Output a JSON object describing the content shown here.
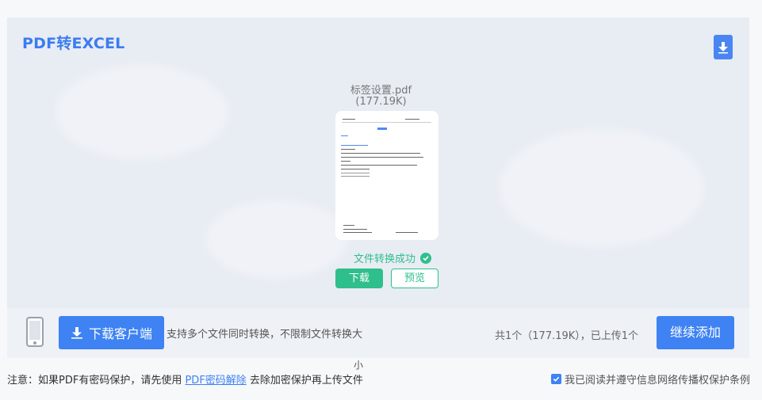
{
  "header": {
    "title": "PDF转EXCEL"
  },
  "file": {
    "name": "标签设置.pdf",
    "size": "(177.19K)"
  },
  "status": {
    "text": "文件转换成功"
  },
  "actions": {
    "download": "下载",
    "preview": "预览"
  },
  "bottom_bar": {
    "client_button": "下载客户端",
    "tip": "支持多个文件同时转换，不限制文件转换大",
    "tip_wrap": "小",
    "summary": "共1个（177.19K），已上传1个",
    "add_button": "继续添加"
  },
  "notice": {
    "prefix": "注意：如果PDF有密码保护，请先使用 ",
    "link": "PDF密码解除",
    "suffix": " 去除加密保护再上传文件"
  },
  "agreement": {
    "label": "我已阅读并遵守信息网络传播权保护条例",
    "checked": true
  },
  "colors": {
    "accent": "#3e82f3",
    "success": "#2fbf8c",
    "panel_bg": "#e8ecf3"
  },
  "icons": [
    "download-icon",
    "check-circle-icon",
    "phone-icon",
    "checkbox-icon"
  ]
}
